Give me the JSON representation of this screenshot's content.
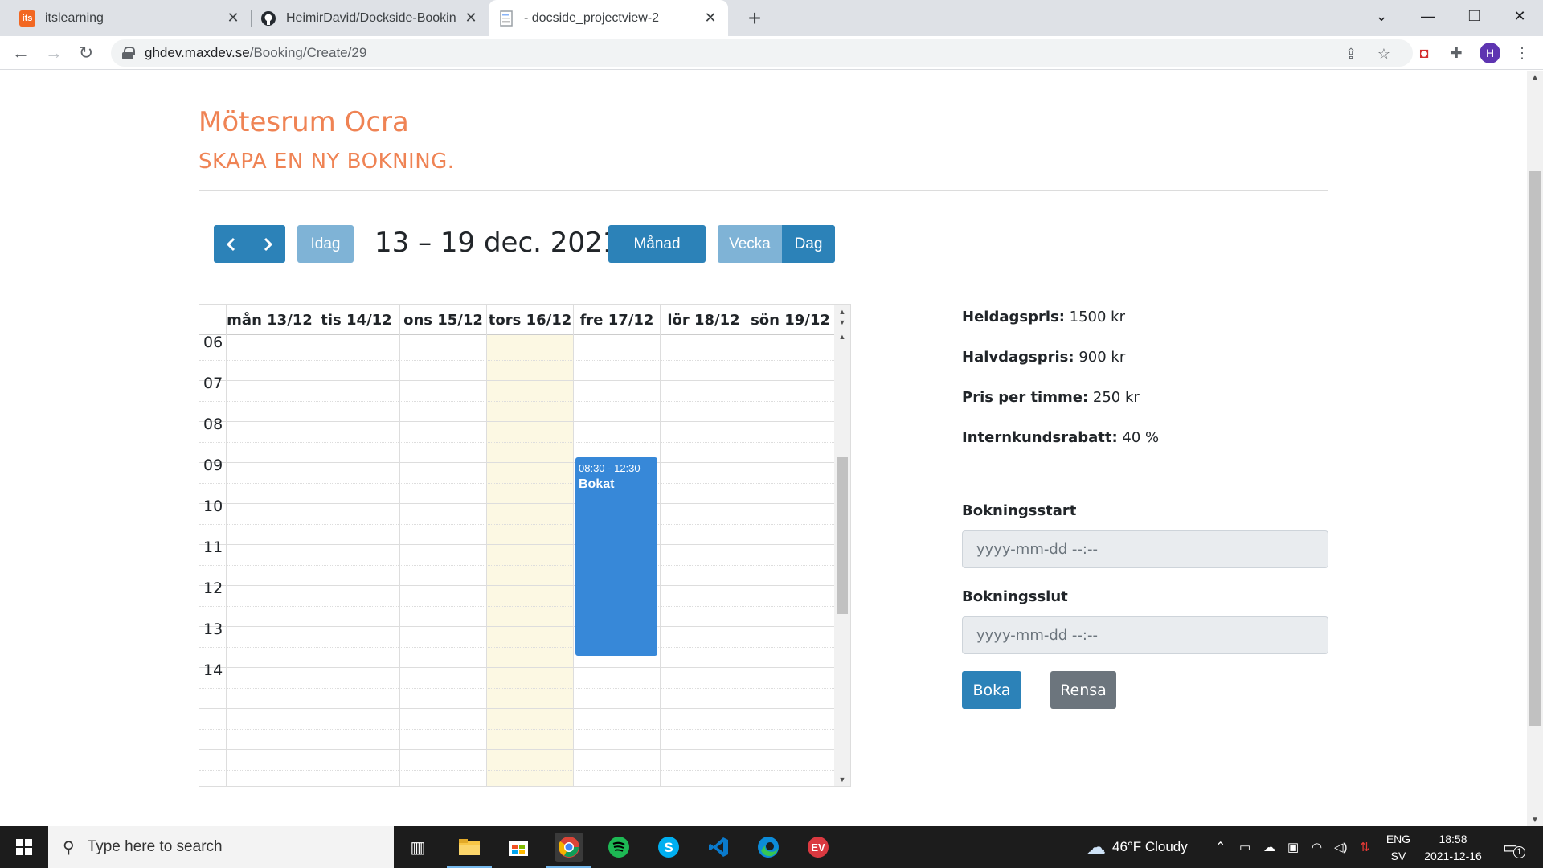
{
  "browser": {
    "tabs": [
      {
        "title": "itslearning",
        "favicon": "its"
      },
      {
        "title": "HeimirDavid/Dockside-Booking-F",
        "favicon": "github-icon"
      },
      {
        "title": "- docside_projectview-2",
        "favicon": "document-icon"
      }
    ],
    "url_host": "ghdev.maxdev.se",
    "url_path": "/Booking/Create/29",
    "profile_initial": "H"
  },
  "page": {
    "room_title": "Mötesrum Ocra",
    "subtitle": "SKAPA EN NY BOKNING.",
    "calendar": {
      "prev_label": "‹",
      "next_label": "›",
      "today_label": "Idag",
      "date_title": "13 – 19 dec. 2021",
      "view_month": "Månad",
      "view_week": "Vecka",
      "view_day": "Dag",
      "days": [
        "mån 13/12",
        "tis 14/12",
        "ons 15/12",
        "tors 16/12",
        "fre 17/12",
        "lör 18/12",
        "sön 19/12"
      ],
      "hours": [
        "06",
        "07",
        "08",
        "09",
        "10",
        "11",
        "12",
        "13",
        "14"
      ],
      "event": {
        "time": "08:30 - 12:30",
        "title": "Bokat"
      }
    },
    "prices": {
      "full_day_label": "Heldagspris:",
      "full_day_value": " 1500 kr",
      "half_day_label": "Halvdagspris:",
      "half_day_value": " 900 kr",
      "hour_label": "Pris per timme:",
      "hour_value": " 250 kr",
      "discount_label": "Internkundsrabatt:",
      "discount_value": " 40 %"
    },
    "form": {
      "start_label": "Bokningsstart",
      "start_placeholder": "yyyy-mm-dd --:--",
      "end_label": "Bokningsslut",
      "end_placeholder": "yyyy-mm-dd --:--",
      "book_button": "Boka",
      "clear_button": "Rensa"
    },
    "colors": {
      "accent": "#ef8354",
      "primary": "#2c82b8",
      "event": "#3788d8",
      "today": "#fcf8e3"
    }
  },
  "taskbar": {
    "search_placeholder": "Type here to search",
    "weather": "46°F  Cloudy",
    "lang_top": "ENG",
    "lang_bottom": "SV",
    "time": "18:58",
    "date": "2021-12-16",
    "notification_count": "1"
  }
}
